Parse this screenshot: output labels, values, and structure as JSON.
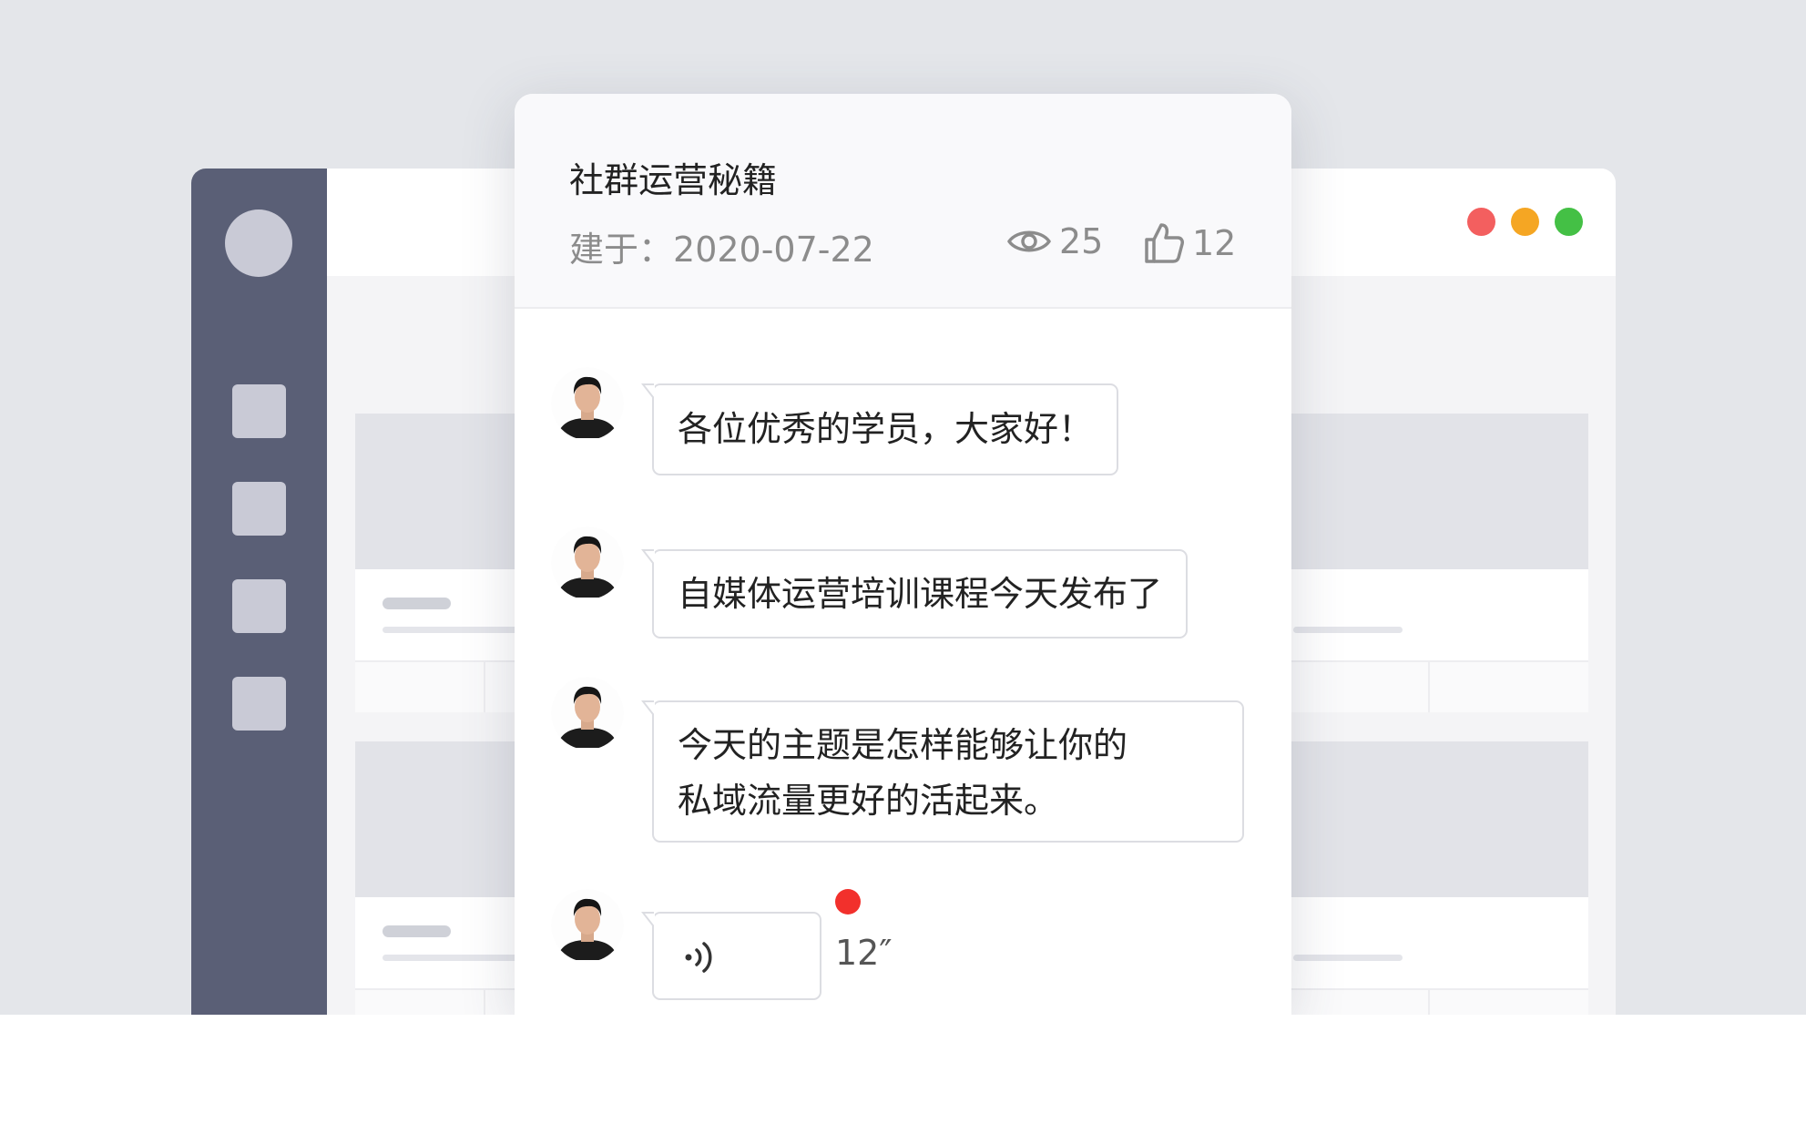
{
  "window": {
    "controls": [
      {
        "name": "close",
        "color": "#f35f5f"
      },
      {
        "name": "minimize",
        "color": "#f5a623"
      },
      {
        "name": "maximize",
        "color": "#44c045"
      }
    ]
  },
  "card": {
    "title": "社群运营秘籍",
    "created_label": "建于：",
    "created_date": "2020-07-22",
    "views": "25",
    "likes": "12"
  },
  "messages": [
    {
      "type": "text",
      "text": "各位优秀的学员，大家好！"
    },
    {
      "type": "text",
      "text": "自媒体运营培训课程今天发布了"
    },
    {
      "type": "text",
      "lines": [
        "今天的主题是怎样能够让你的",
        "私域流量更好的活起来。"
      ]
    },
    {
      "type": "voice",
      "duration": "12″",
      "unread": true
    }
  ],
  "colors": {
    "sidebar": "#5a5f76",
    "unread": "#f2302c",
    "backdrop": "#e4e6ea"
  }
}
